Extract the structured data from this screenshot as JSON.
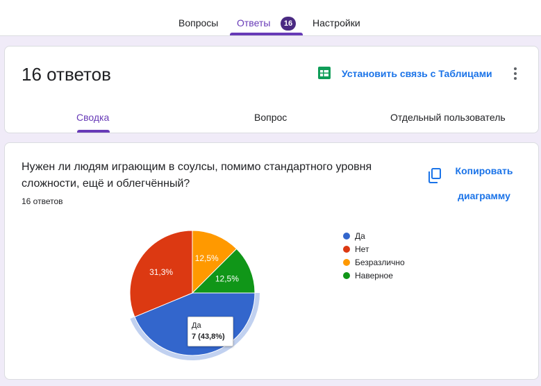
{
  "top_tabs": [
    {
      "label": "Вопросы"
    },
    {
      "label": "Ответы",
      "badge": "16"
    },
    {
      "label": "Настройки"
    }
  ],
  "summary": {
    "title": "16 ответов",
    "link_sheets": "Установить связь с Таблицами",
    "subtabs": [
      "Сводка",
      "Вопрос",
      "Отдельный пользователь"
    ]
  },
  "question": {
    "text": "Нужен ли людям играющим в соулсы,  помимо стандартного уровня сложности, ещё и облегчённый?",
    "count": "16 ответов",
    "copy_line1": "Копировать",
    "copy_line2": "диаграмму",
    "tooltip_label": "Да",
    "tooltip_value": "7 (43,8%)"
  },
  "chart_data": {
    "type": "pie",
    "slices": [
      {
        "label": "Да",
        "value": 7,
        "percent_label": "",
        "color": "#3366cc"
      },
      {
        "label": "Нет",
        "value": 5,
        "percent_label": "31,3%",
        "color": "#dc3912"
      },
      {
        "label": "Безразлично",
        "value": 2,
        "percent_label": "12,5%",
        "color": "#ff9900"
      },
      {
        "label": "Наверное",
        "value": 2,
        "percent_label": "12,5%",
        "color": "#109618"
      }
    ],
    "highlighted": "Да",
    "legend_position": "right"
  },
  "colors": {
    "accent": "#673ab7",
    "link": "#1a73e8",
    "sheets_green": "#0f9d58"
  }
}
